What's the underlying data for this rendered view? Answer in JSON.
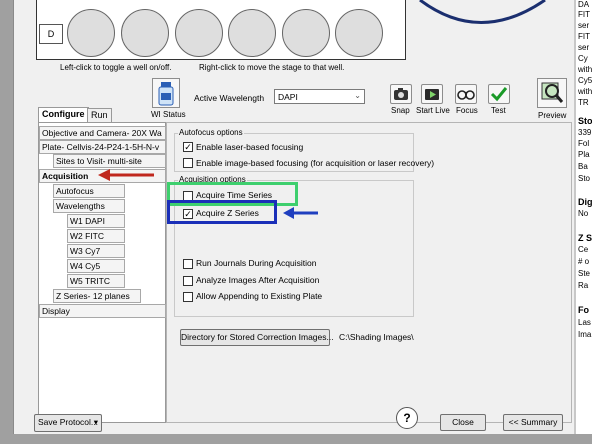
{
  "plate": {
    "row_label": "D",
    "hint_left": "Left-click to toggle a well on/off.",
    "hint_right": "Right-click to move the stage to that well."
  },
  "toolbar": {
    "wi_status": "WI Status",
    "active_wavelength_label": "Active Wavelength",
    "active_wavelength_value": "DAPI",
    "snap": "Snap",
    "start_live": "Start Live",
    "focus": "Focus",
    "test": "Test",
    "preview": "Preview"
  },
  "tabs": [
    {
      "label": "Configure",
      "active": true
    },
    {
      "label": "Run",
      "active": false
    }
  ],
  "tree": [
    {
      "label": "Objective and Camera- 20X Wa",
      "level": 0
    },
    {
      "label": "Plate- Cellvis-24-P24-1-5H-N-v",
      "level": 0
    },
    {
      "label": "Sites to Visit- multi-site",
      "level": 1
    },
    {
      "label": "Acquisition",
      "level": 0,
      "selected": true
    },
    {
      "label": "Autofocus",
      "level": 1
    },
    {
      "label": "Wavelengths",
      "level": 1
    },
    {
      "label": "W1 DAPI",
      "level": 2
    },
    {
      "label": "W2 FITC",
      "level": 2
    },
    {
      "label": "W3 Cy7",
      "level": 2
    },
    {
      "label": "W4 Cy5",
      "level": 2
    },
    {
      "label": "W5 TRITC",
      "level": 2
    },
    {
      "label": "Z Series- 12 planes",
      "level": 1
    },
    {
      "label": "Display",
      "level": 0
    }
  ],
  "autofocus": {
    "title": "Autofocus options",
    "laser": {
      "label": "Enable laser-based focusing",
      "checked": true
    },
    "image": {
      "label": "Enable image-based focusing (for acquisition or laser recovery)",
      "checked": false
    }
  },
  "acquisition": {
    "title": "Acquisition options",
    "time_series": {
      "label": "Acquire Time Series",
      "checked": false
    },
    "z_series": {
      "label": "Acquire Z Series",
      "checked": true
    },
    "run_journals": {
      "label": "Run Journals During Acquisition",
      "checked": false
    },
    "analyze": {
      "label": "Analyze Images After Acquisition",
      "checked": false
    },
    "append": {
      "label": "Allow Appending to Existing Plate",
      "checked": false
    }
  },
  "directory": {
    "button": "Directory for Stored Correction Images...",
    "path": "C:\\Shading Images\\"
  },
  "bottom": {
    "save_protocol": "Save Protocol...",
    "help": "?",
    "close": "Close",
    "summary": "<< Summary"
  },
  "right_pane": {
    "lines": [
      "DA",
      "FIT",
      "ser",
      "FIT",
      "ser",
      "Cy",
      "with",
      "Cy5",
      "with",
      "TR"
    ],
    "heading1": "Sto",
    "lines2": [
      "339",
      "Fol",
      "Pla",
      "Ba",
      "Sto"
    ],
    "heading2": "Dig",
    "lines3": [
      "No"
    ],
    "heading3": "Z S",
    "lines4": [
      "Ce",
      "# o",
      "Ste",
      "Ra"
    ],
    "heading4": "Fo",
    "lines5": [
      "Las",
      "Ima"
    ]
  },
  "colors": {
    "annotation_arrow_red": "#c0281e",
    "annotation_arrow_blue": "#1f3fbf",
    "annotation_box_green": "#3ecf6e",
    "annotation_box_blue": "#1a2fb8",
    "test_check_green": "#1a9a28"
  }
}
